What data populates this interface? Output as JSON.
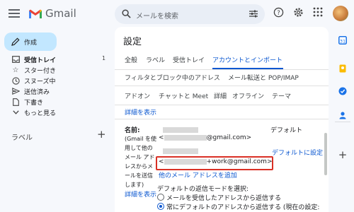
{
  "header": {
    "app_name": "Gmail",
    "search_placeholder": "メールを検索"
  },
  "sidebar": {
    "compose_label": "作成",
    "items": [
      {
        "label": "受信トレイ",
        "icon": "inbox-icon",
        "count": "1"
      },
      {
        "label": "スター付き",
        "icon": "star-icon"
      },
      {
        "label": "スヌーズ中",
        "icon": "clock-icon"
      },
      {
        "label": "送信済み",
        "icon": "send-icon"
      },
      {
        "label": "下書き",
        "icon": "draft-icon"
      },
      {
        "label": "もっと見る",
        "icon": "chevron-down-icon"
      }
    ],
    "labels_heading": "ラベル",
    "labels_add": "+"
  },
  "settings": {
    "title": "設定",
    "tabs_row1": [
      "全般",
      "ラベル",
      "受信トレイ",
      "アカウントとインポート"
    ],
    "tabs_row2": [
      "フィルタとブロック中のアドレス",
      "メール転送と POP/IMAP"
    ],
    "tabs_row3": [
      "アドオン",
      "チャットと Meet",
      "詳細",
      "オフライン",
      "テーマ"
    ],
    "show_details_1": "詳細を表示",
    "name_label": "名前:",
    "name_desc": [
      "(Gmail を使",
      "用して他の",
      "メール アド",
      "レスからメ",
      "ールを送信",
      "します)"
    ],
    "show_details_2": "詳細を表示",
    "address1_prefix": "<",
    "address1_suffix": "@gmail.com>",
    "address2_prefix": "<",
    "address2_suffix": "+work@gmail.com>",
    "default_label": "デフォルト",
    "make_default_link": "デフォルトに設定",
    "add_address_link": "他のメール アドレスを追加",
    "reply_mode_heading": "デフォルトの返信モードを選択:",
    "reply_option1": "メールを受信したアドレスから返信する",
    "reply_option2": "常にデフォルトのアドレスから返信する (現在の設定:"
  },
  "colors": {
    "accent": "#0b57d0",
    "compose_bg": "#c2e7ff",
    "highlight_box": "#d93025"
  }
}
